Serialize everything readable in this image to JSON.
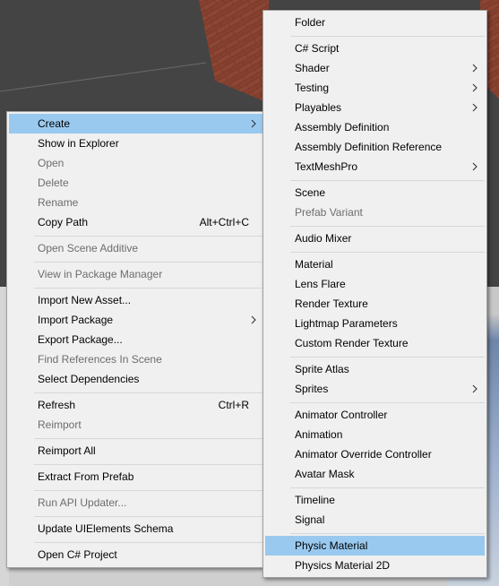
{
  "colors": {
    "menu_bg": "#f0f0f0",
    "highlight": "#99c9ef",
    "disabled_text": "#6d6d6d",
    "separator": "#d7d7d7"
  },
  "context_menu": {
    "create": "Create",
    "show_in_explorer": "Show in Explorer",
    "open": "Open",
    "delete": "Delete",
    "rename": "Rename",
    "copy_path": "Copy Path",
    "copy_path_shortcut": "Alt+Ctrl+C",
    "open_scene_additive": "Open Scene Additive",
    "view_in_package_manager": "View in Package Manager",
    "import_new_asset": "Import New Asset...",
    "import_package": "Import Package",
    "export_package": "Export Package...",
    "find_references_in_scene": "Find References In Scene",
    "select_dependencies": "Select Dependencies",
    "refresh": "Refresh",
    "refresh_shortcut": "Ctrl+R",
    "reimport": "Reimport",
    "reimport_all": "Reimport All",
    "extract_from_prefab": "Extract From Prefab",
    "run_api_updater": "Run API Updater...",
    "update_uielements_schema": "Update UIElements Schema",
    "open_csharp_project": "Open C# Project"
  },
  "create_submenu": {
    "folder": "Folder",
    "csharp_script": "C# Script",
    "shader": "Shader",
    "testing": "Testing",
    "playables": "Playables",
    "assembly_definition": "Assembly Definition",
    "assembly_definition_reference": "Assembly Definition Reference",
    "textmeshpro": "TextMeshPro",
    "scene": "Scene",
    "prefab_variant": "Prefab Variant",
    "audio_mixer": "Audio Mixer",
    "material": "Material",
    "lens_flare": "Lens Flare",
    "render_texture": "Render Texture",
    "lightmap_parameters": "Lightmap Parameters",
    "custom_render_texture": "Custom Render Texture",
    "sprite_atlas": "Sprite Atlas",
    "sprites": "Sprites",
    "animator_controller": "Animator Controller",
    "animation": "Animation",
    "animator_override_controller": "Animator Override Controller",
    "avatar_mask": "Avatar Mask",
    "timeline": "Timeline",
    "signal": "Signal",
    "physic_material": "Physic Material",
    "physics_material_2d": "Physics Material 2D"
  }
}
